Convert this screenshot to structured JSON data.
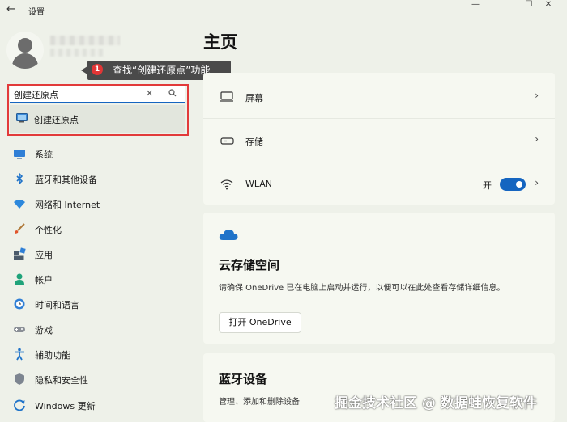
{
  "window": {
    "title": "设置",
    "back_glyph": "←",
    "minimize_glyph": "—",
    "maximize_glyph": "☐",
    "close_glyph": "✕"
  },
  "callout": {
    "badge": "1",
    "text": "查找“创建还原点”功能"
  },
  "search": {
    "value": "创建还原点",
    "clear_glyph": "✕",
    "result_label": "创建还原点"
  },
  "sidebar": {
    "items": [
      {
        "label": "系统",
        "icon": "monitor-icon"
      },
      {
        "label": "蓝牙和其他设备",
        "icon": "bluetooth-icon"
      },
      {
        "label": "网络和 Internet",
        "icon": "wifi-icon"
      },
      {
        "label": "个性化",
        "icon": "brush-icon"
      },
      {
        "label": "应用",
        "icon": "apps-icon"
      },
      {
        "label": "帐户",
        "icon": "account-icon"
      },
      {
        "label": "时间和语言",
        "icon": "globe-clock-icon"
      },
      {
        "label": "游戏",
        "icon": "gamepad-icon"
      },
      {
        "label": "辅助功能",
        "icon": "accessibility-icon"
      },
      {
        "label": "隐私和安全性",
        "icon": "shield-icon"
      },
      {
        "label": "Windows 更新",
        "icon": "update-icon"
      }
    ]
  },
  "main": {
    "title": "主页",
    "rows": [
      {
        "label": "屏幕",
        "icon": "display-icon"
      },
      {
        "label": "存储",
        "icon": "storage-icon"
      },
      {
        "label": "WLAN",
        "icon": "wifi-icon",
        "toggle_label": "开",
        "toggle_on": true
      }
    ],
    "chevron_glyph": "›",
    "cloud": {
      "title": "云存储空间",
      "description": "请确保 OneDrive 已在电脑上启动并运行，以便可以在此处查看存储详细信息。",
      "button": "打开 OneDrive"
    },
    "bluetooth": {
      "title": "蓝牙设备",
      "description": "管理、添加和删除设备"
    }
  },
  "watermark": "掘金技术社区 @ 数据蛙恢复软件",
  "colors": {
    "accent": "#1565c0",
    "highlight_frame": "#e23a3a",
    "badge": "#e23636",
    "background": "#eef1e9"
  }
}
